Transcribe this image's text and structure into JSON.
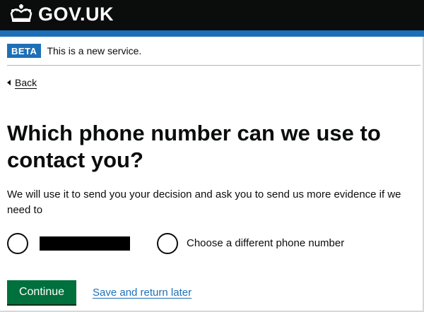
{
  "header": {
    "logo_text": "GOV.UK",
    "logo_icon": "crown-icon",
    "background_color": "#0b0c0c",
    "stripe_color": "#1d70b8"
  },
  "phase_banner": {
    "tag": "BETA",
    "text": "This is a new service.",
    "tag_color": "#1d70b8"
  },
  "back_link": {
    "label": "Back",
    "icon": "back-arrow-icon"
  },
  "question": {
    "heading": "Which phone number can we use to contact you?",
    "hint": "We will use it to send you your decision and ask you to send us more evidence if we need to"
  },
  "radios": {
    "options": [
      {
        "label": "",
        "redacted": true,
        "selected": false
      },
      {
        "label": "Choose a different phone number",
        "redacted": false,
        "selected": false
      }
    ]
  },
  "actions": {
    "continue_label": "Continue",
    "continue_color": "#00703c",
    "save_label": "Save and return later",
    "link_color": "#1d70b8"
  }
}
